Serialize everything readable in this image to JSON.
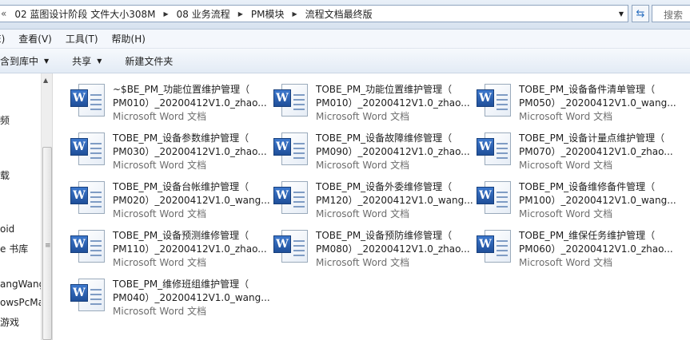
{
  "address": {
    "lead": "«",
    "crumbs": [
      "02 蓝图设计阶段 文件大小308M",
      "08 业务流程",
      "PM模块",
      "流程文档最终版"
    ],
    "search_placeholder": "搜索"
  },
  "menu": [
    "E)",
    "查看(V)",
    "工具(T)",
    "帮助(H)"
  ],
  "toolbar": {
    "include_library": "包含到库中",
    "share": "共享",
    "new_folder": "新建文件夹"
  },
  "nav": [
    "频",
    "载",
    "oid",
    "e 书库",
    "angWang",
    "owsPcMa",
    "游戏"
  ],
  "files": [
    {
      "line1": "~$BE_PM_功能位置维护管理（",
      "line2": "PM010）_20200412V1.0_zhao...",
      "type": "Microsoft Word 文档"
    },
    {
      "line1": "TOBE_PM_功能位置维护管理（",
      "line2": "PM010）_20200412V1.0_zhao...",
      "type": "Microsoft Word 文档"
    },
    {
      "line1": "TOBE_PM_设备备件清单管理（",
      "line2": "PM050）_20200412V1.0_wang...",
      "type": "Microsoft Word 文档"
    },
    {
      "line1": "TOBE_PM_设备参数维护管理（",
      "line2": "PM030）_20200412V1.0_zhao...",
      "type": "Microsoft Word 文档"
    },
    {
      "line1": "TOBE_PM_设备故障维修管理（",
      "line2": "PM090）_20200412V1.0_zhao...",
      "type": "Microsoft Word 文档"
    },
    {
      "line1": "TOBE_PM_设备计量点维护管理（",
      "line2": "PM070）_20200412V1.0_zhao...",
      "type": "Microsoft Word 文档"
    },
    {
      "line1": "TOBE_PM_设备台帐维护管理（",
      "line2": "PM020）_20200412V1.0_wang...",
      "type": "Microsoft Word 文档"
    },
    {
      "line1": "TOBE_PM_设备外委维修管理（",
      "line2": "PM120）_20200412V1.0_wang...",
      "type": "Microsoft Word 文档"
    },
    {
      "line1": "TOBE_PM_设备维修备件管理（",
      "line2": "PM100）_20200412V1.0_wang...",
      "type": "Microsoft Word 文档"
    },
    {
      "line1": "TOBE_PM_设备预测维修管理（",
      "line2": "PM110）_20200412V1.0_zhao...",
      "type": "Microsoft Word 文档"
    },
    {
      "line1": "TOBE_PM_设备预防维修管理（",
      "line2": "PM080）_20200412V1.0_zhao...",
      "type": "Microsoft Word 文档"
    },
    {
      "line1": "TOBE_PM_维保任务维护管理（",
      "line2": "PM060）_20200412V1.0_zhao...",
      "type": "Microsoft Word 文档"
    },
    {
      "line1": "TOBE_PM_维修班组维护管理（",
      "line2": "PM040）_20200412V1.0_wang...",
      "type": "Microsoft Word 文档"
    }
  ]
}
